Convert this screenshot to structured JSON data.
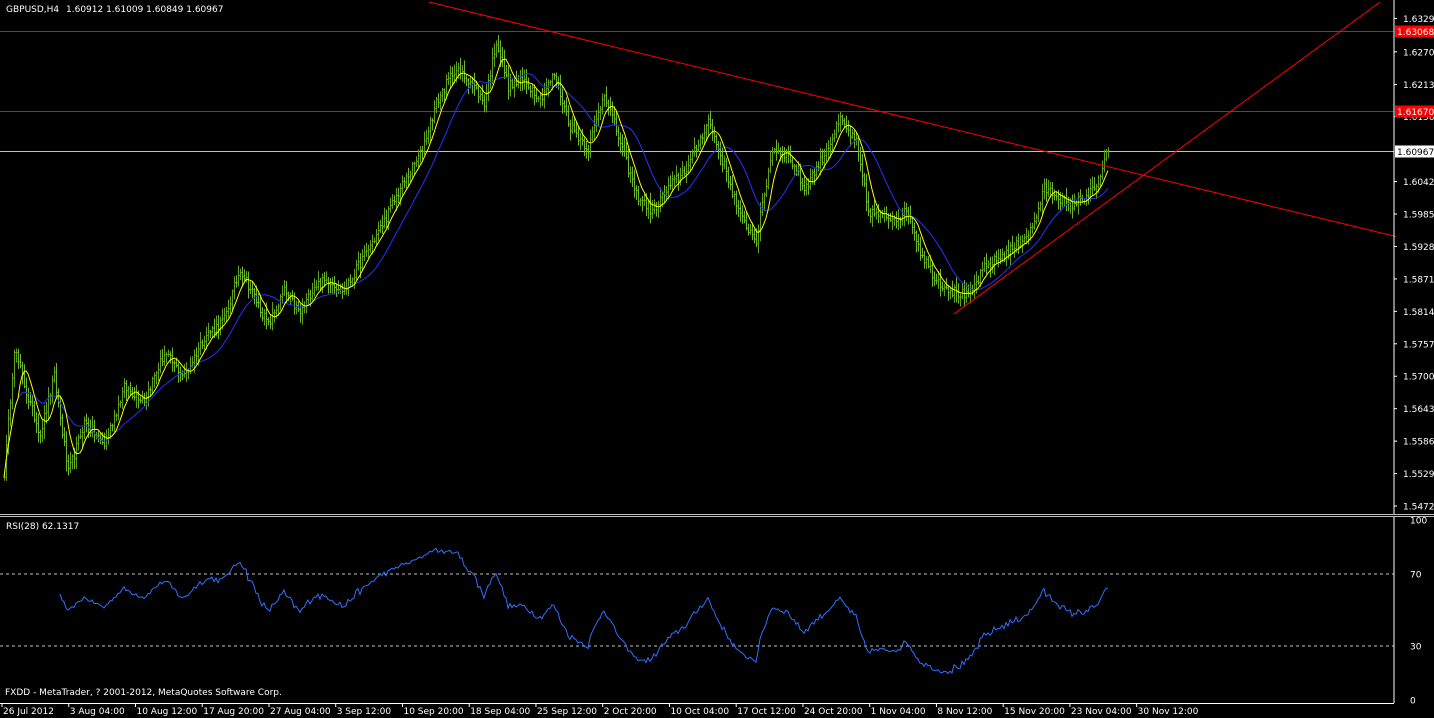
{
  "header": {
    "symbol": "GBPUSD,H4",
    "ohlc": "1.60912 1.61009 1.60849 1.60967"
  },
  "footer": {
    "copyright": "FXDD - MetaTrader, ? 2001-2012, MetaQuotes Software Corp."
  },
  "colors": {
    "background": "#000000",
    "bar": "#5fa01e",
    "bar_bear": "#6fb82e",
    "ma_fast": "#ffff00",
    "ma_slow": "#2233ff",
    "trendline": "#ff0000",
    "hline": "#ff0000",
    "rsi": "#3070ff",
    "axis": "#ffffff"
  },
  "chart_data": {
    "type": "ohlc",
    "price_axis": {
      "ticks": [
        "1.63290",
        "1.62705",
        "1.62130",
        "1.61565",
        "1.60425",
        "1.59855",
        "1.59285",
        "1.58715",
        "1.58145",
        "1.57575",
        "1.57005",
        "1.56435",
        "1.55865",
        "1.55295",
        "1.54725"
      ],
      "ylim": [
        1.5462,
        1.6358
      ]
    },
    "time_axis": {
      "labels": [
        "26 Jul 2012",
        "3 Aug 04:00",
        "10 Aug 12:00",
        "17 Aug 20:00",
        "27 Aug 04:00",
        "3 Sep 12:00",
        "10 Sep 20:00",
        "18 Sep 04:00",
        "25 Sep 12:00",
        "2 Oct 20:00",
        "10 Oct 04:00",
        "17 Oct 12:00",
        "24 Oct 20:00",
        "1 Nov 04:00",
        "8 Nov 12:00",
        "15 Nov 20:00",
        "23 Nov 04:00",
        "30 Nov 12:00"
      ]
    },
    "current_price": {
      "label": "1.60967",
      "value": 1.60967
    },
    "horizontal_lines": [
      {
        "label": "1.63068",
        "value": 1.63068
      },
      {
        "label": "1.61670",
        "value": 1.6167
      }
    ],
    "anchors": [
      {
        "i": 0,
        "p": 1.553
      },
      {
        "i": 5,
        "p": 1.575
      },
      {
        "i": 12,
        "p": 1.566
      },
      {
        "i": 18,
        "p": 1.56
      },
      {
        "i": 25,
        "p": 1.57
      },
      {
        "i": 32,
        "p": 1.553
      },
      {
        "i": 40,
        "p": 1.562
      },
      {
        "i": 50,
        "p": 1.558
      },
      {
        "i": 60,
        "p": 1.568
      },
      {
        "i": 70,
        "p": 1.566
      },
      {
        "i": 80,
        "p": 1.574
      },
      {
        "i": 90,
        "p": 1.57
      },
      {
        "i": 100,
        "p": 1.577
      },
      {
        "i": 110,
        "p": 1.58
      },
      {
        "i": 118,
        "p": 1.589
      },
      {
        "i": 125,
        "p": 1.584
      },
      {
        "i": 132,
        "p": 1.579
      },
      {
        "i": 140,
        "p": 1.585
      },
      {
        "i": 148,
        "p": 1.581
      },
      {
        "i": 155,
        "p": 1.586
      },
      {
        "i": 162,
        "p": 1.587
      },
      {
        "i": 170,
        "p": 1.585
      },
      {
        "i": 178,
        "p": 1.59
      },
      {
        "i": 188,
        "p": 1.596
      },
      {
        "i": 198,
        "p": 1.603
      },
      {
        "i": 208,
        "p": 1.609
      },
      {
        "i": 216,
        "p": 1.618
      },
      {
        "i": 225,
        "p": 1.624
      },
      {
        "i": 233,
        "p": 1.622
      },
      {
        "i": 240,
        "p": 1.618
      },
      {
        "i": 246,
        "p": 1.629
      },
      {
        "i": 252,
        "p": 1.621
      },
      {
        "i": 260,
        "p": 1.622
      },
      {
        "i": 268,
        "p": 1.619
      },
      {
        "i": 275,
        "p": 1.623
      },
      {
        "i": 283,
        "p": 1.614
      },
      {
        "i": 292,
        "p": 1.61
      },
      {
        "i": 300,
        "p": 1.62
      },
      {
        "i": 308,
        "p": 1.611
      },
      {
        "i": 316,
        "p": 1.602
      },
      {
        "i": 324,
        "p": 1.599
      },
      {
        "i": 332,
        "p": 1.603
      },
      {
        "i": 342,
        "p": 1.607
      },
      {
        "i": 352,
        "p": 1.615
      },
      {
        "i": 360,
        "p": 1.607
      },
      {
        "i": 368,
        "p": 1.598
      },
      {
        "i": 376,
        "p": 1.594
      },
      {
        "i": 384,
        "p": 1.61
      },
      {
        "i": 392,
        "p": 1.609
      },
      {
        "i": 400,
        "p": 1.603
      },
      {
        "i": 410,
        "p": 1.609
      },
      {
        "i": 418,
        "p": 1.615
      },
      {
        "i": 426,
        "p": 1.611
      },
      {
        "i": 432,
        "p": 1.599
      },
      {
        "i": 440,
        "p": 1.598
      },
      {
        "i": 446,
        "p": 1.598
      },
      {
        "i": 452,
        "p": 1.599
      },
      {
        "i": 458,
        "p": 1.592
      },
      {
        "i": 466,
        "p": 1.587
      },
      {
        "i": 474,
        "p": 1.585
      },
      {
        "i": 482,
        "p": 1.584
      },
      {
        "i": 490,
        "p": 1.589
      },
      {
        "i": 498,
        "p": 1.591
      },
      {
        "i": 506,
        "p": 1.593
      },
      {
        "i": 514,
        "p": 1.596
      },
      {
        "i": 520,
        "p": 1.603
      },
      {
        "i": 526,
        "p": 1.602
      },
      {
        "i": 532,
        "p": 1.6
      },
      {
        "i": 538,
        "p": 1.601
      },
      {
        "i": 546,
        "p": 1.603
      },
      {
        "i": 552,
        "p": 1.61
      }
    ],
    "ma_fast_period": 8,
    "ma_slow_period": 21,
    "trendlines": [
      {
        "i1": 196,
        "p1": 1.6372,
        "i2": 696,
        "p2": 1.5946
      },
      {
        "i1": 475,
        "p1": 1.581,
        "i2": 690,
        "p2": 1.6363
      }
    ],
    "rsi": {
      "label": "RSI(28) 62.1317",
      "period": 28,
      "value": 62.1317,
      "levels": [
        70,
        30
      ],
      "ticks": [
        "100",
        "70",
        "30",
        "0"
      ],
      "ylim": [
        0,
        100
      ]
    }
  }
}
